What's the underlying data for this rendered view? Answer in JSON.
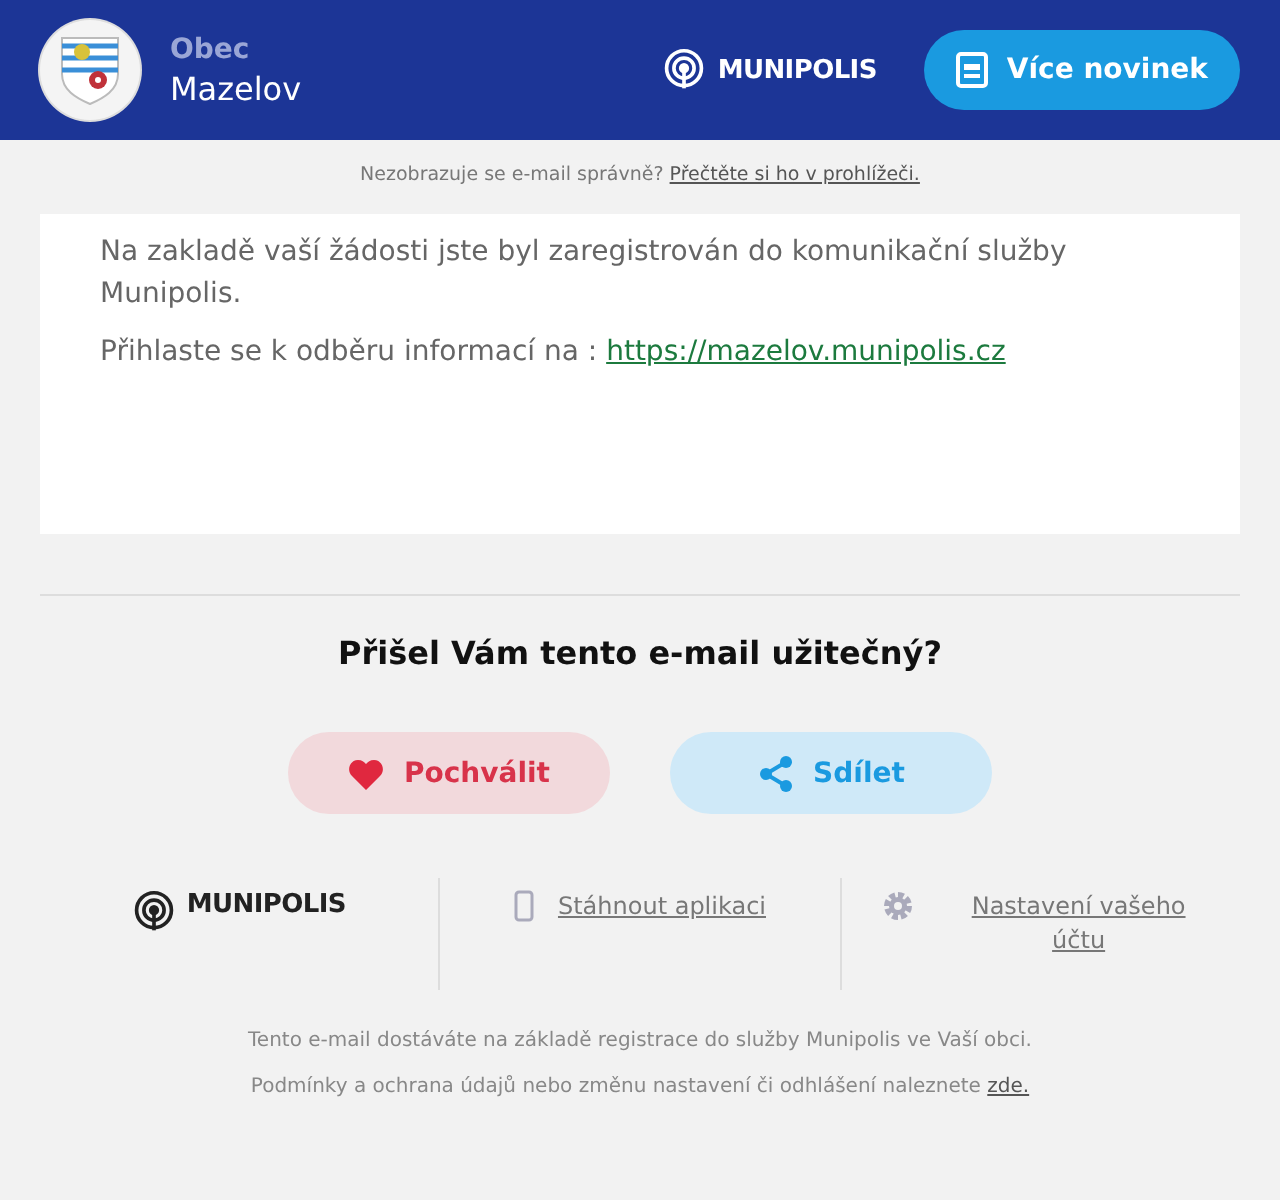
{
  "header": {
    "label": "Obec",
    "name": "Mazelov",
    "brand": "MUNIPOLIS",
    "button": "Více novinek"
  },
  "preheader": {
    "text": "Nezobrazuje se e-mail správně?",
    "link": "Přečtěte si ho v prohlížeči."
  },
  "message": {
    "paragraph": "Na zakladě vaší žádosti jste byl zaregistrován do komunikační služby Munipolis.",
    "prompt": "Přihlaste se k odběru informací na : ",
    "link": "https://mazelov.munipolis.cz"
  },
  "feedback": {
    "question": "Přišel Vám tento e-mail užitečný?",
    "buttons": [
      {
        "kind": "like",
        "label": "Pochválit"
      },
      {
        "kind": "share",
        "label": "Sdílet"
      }
    ]
  },
  "footer_links": [
    {
      "kind": "brand",
      "label": "MUNIPOLIS"
    },
    {
      "kind": "app",
      "label": "Stáhnout aplikaci"
    },
    {
      "kind": "settings",
      "label": "Nastavení vašeho účtu"
    }
  ],
  "footer": {
    "note": "Tento e-mail dostáváte na základě registrace do služby Munipolis ve Vaší obci.",
    "terms": "Podmínky a ochrana údajů nebo změnu nastavení či odhlášení naleznete ",
    "terms_link": "zde."
  }
}
